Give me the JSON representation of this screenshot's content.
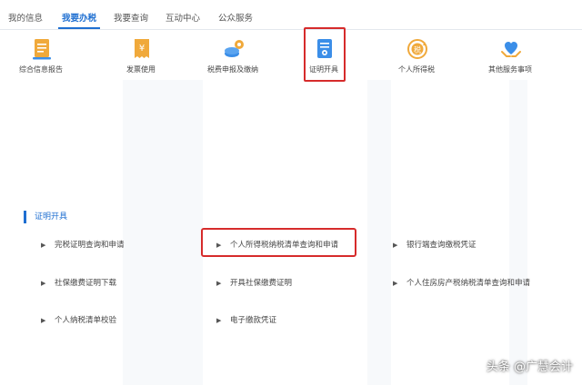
{
  "tabs": [
    {
      "label": "我的信息",
      "active": false
    },
    {
      "label": "我要办税",
      "active": true
    },
    {
      "label": "我要查询",
      "active": false
    },
    {
      "label": "互动中心",
      "active": false
    },
    {
      "label": "公众服务",
      "active": false
    }
  ],
  "icons": [
    {
      "label": "综合信息报告",
      "icon": "report-document-icon",
      "color": "#f0a93b"
    },
    {
      "label": "发票使用",
      "icon": "invoice-receipt-icon",
      "color": "#f0a93b"
    },
    {
      "label": "税费申报及缴纳",
      "icon": "coins-payment-icon",
      "color": "#3b8ee8"
    },
    {
      "label": "证明开具",
      "icon": "certificate-document-icon",
      "color": "#3b8ee8",
      "highlighted": true
    },
    {
      "label": "个人所得税",
      "icon": "tax-refresh-icon",
      "color": "#f0a93b"
    },
    {
      "label": "其他服务事项",
      "icon": "heart-hands-icon",
      "color": "#3b8ee8"
    }
  ],
  "section": {
    "title": "证明开具",
    "items": [
      "完税证明查询和申请",
      "个人所得税纳税清单查询和申请",
      "银行端查询缴税凭证",
      "社保缴费证明下载",
      "开具社保缴费证明",
      "个人住房房产税纳税清单查询和申请",
      "个人纳税清单校验",
      "电子缴款凭证"
    ],
    "bullet": "▶"
  },
  "highlight_color": "#d62b2b",
  "accent_color": "#1f6fd1",
  "watermark": "头条 @广慧会计"
}
